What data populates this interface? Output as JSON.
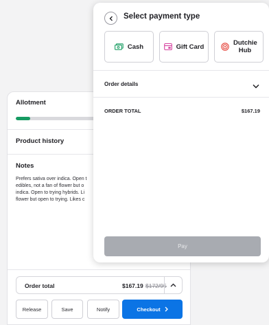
{
  "cart": {
    "allotment": {
      "title": "Allotment",
      "progress_percent": 14
    },
    "product_history": {
      "title": "Product history"
    },
    "notes": {
      "title": "Notes",
      "lines": [
        "Prefers sativa over indica. Open t",
        "edibles, not a fan of flower but o",
        "indica. Open to trying hybrids. Li",
        "flower but open to trying. Likes c"
      ]
    },
    "order_total": {
      "label": "Order total",
      "value": "$167.19",
      "original_value": "$172/95"
    },
    "buttons": {
      "release": "Release",
      "save": "Save",
      "notify": "Notify",
      "checkout": "Checkout"
    }
  },
  "payment": {
    "title": "Select payment type",
    "options": [
      {
        "label": "Cash",
        "icon": "cash-icon",
        "color": "#1a9e63"
      },
      {
        "label": "Gift Card",
        "icon": "gift-card-icon",
        "color": "#d6409f"
      },
      {
        "label": "Dutchie Hub",
        "icon": "dutchie-hub-icon",
        "color": "#e5443b"
      }
    ],
    "order_details": {
      "label": "Order details"
    },
    "order_total": {
      "label": "ORDER TOTAL",
      "value": "$167.19"
    },
    "pay_button": {
      "label": "Pay"
    }
  },
  "colors": {
    "accent_blue": "#0b74e5",
    "progress_green": "#169b62",
    "pay_disabled": "#a8abb1"
  }
}
